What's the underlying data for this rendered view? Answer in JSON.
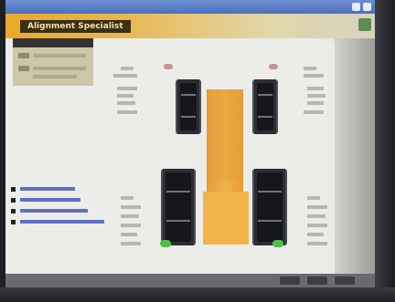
{
  "window": {
    "title": "Alignment Specialist",
    "accent": "#e8a92c",
    "titlebar_bg": "#4a70bd"
  },
  "info_panel": {
    "header": "",
    "icons": [
      "chip",
      "chip"
    ]
  },
  "wheels": {
    "front_left": {
      "name": "front-left"
    },
    "front_right": {
      "name": "front-right"
    },
    "rear_left": {
      "name": "rear-left"
    },
    "rear_right": {
      "name": "rear-right"
    }
  },
  "status": {
    "front_indicator": "#c79292",
    "rear_indicator": "#51bd48"
  },
  "legend": {
    "items": [
      "",
      "",
      ""
    ]
  }
}
